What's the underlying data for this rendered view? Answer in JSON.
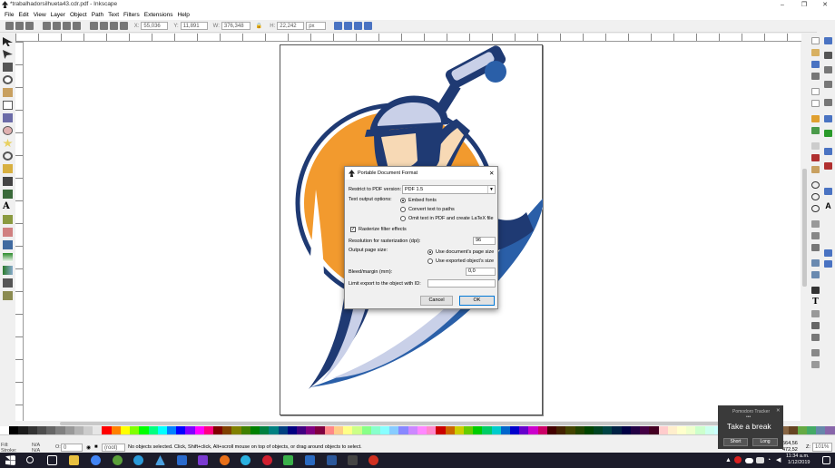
{
  "window": {
    "title": "*trabalhadorsilhueta43.cdr.pdf - Inkscape",
    "minimize": "–",
    "maximize": "❐",
    "close": "✕"
  },
  "menu": [
    "File",
    "Edit",
    "View",
    "Layer",
    "Object",
    "Path",
    "Text",
    "Filters",
    "Extensions",
    "Help"
  ],
  "toolctrl": {
    "x_label": "X:",
    "x_value": "55,036",
    "y_label": "Y:",
    "y_value": "11,891",
    "w_label": "W:",
    "w_value": "376,348",
    "h_label": "H:",
    "h_value": "22,242",
    "unit": "px"
  },
  "dialog": {
    "title": "Portable Document Format",
    "close": "✕",
    "restrict_label": "Restrict to PDF version:",
    "restrict_value": "PDF 1.5",
    "text_output_label": "Text output options:",
    "text_options": [
      "Embed fonts",
      "Convert text to paths",
      "Omit text in PDF and create LaTeX file"
    ],
    "text_option_selected": 0,
    "rasterize_label": "Rasterize filter effects",
    "rasterize_checked": true,
    "resolution_label": "Resolution for rasterization (dpi):",
    "resolution_value": "96",
    "page_size_label": "Output page size:",
    "page_options": [
      "Use document's page size",
      "Use exported object's size"
    ],
    "page_option_selected": 0,
    "bleed_label": "Bleed/margin (mm):",
    "bleed_value": "0,0",
    "limit_label": "Limit export to the object with ID:",
    "limit_value": "",
    "cancel": "Cancel",
    "ok": "OK"
  },
  "status": {
    "fill_label": "Fill:",
    "fill_value": "N/A",
    "stroke_label": "Stroke:",
    "stroke_value": "N/A",
    "opacity_label": "O:",
    "opacity_value": "0",
    "layer": "(root)",
    "message": "No objects selected. Click, Shift+click, Alt+scroll mouse on top of objects, or drag around objects to select.",
    "cursor_x": "564,56",
    "cursor_y": "472,52",
    "zoom_label": "Z:",
    "zoom": "101%"
  },
  "toast": {
    "header": "Pomodoro Tracker",
    "title": "Take a break",
    "short": "Short",
    "long": "Long"
  },
  "taskbar": {
    "time": "11:34 a.m.",
    "date": "1/12/2019"
  },
  "colors": {
    "orange": "#f29a2e",
    "navy": "#1f3a73",
    "blue": "#2a5fa8",
    "cream": "#f7d9b5",
    "lavender": "#c9d0e8"
  }
}
